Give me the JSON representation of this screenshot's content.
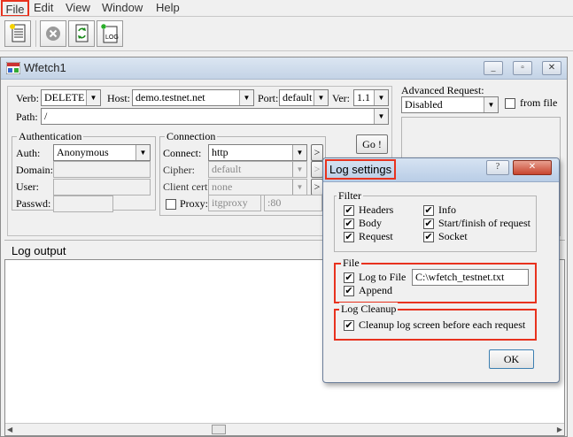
{
  "menu": {
    "items": [
      "File",
      "Edit",
      "View",
      "Window",
      "Help"
    ]
  },
  "toolbar": {
    "buttons": [
      "new-request-icon",
      "stop-icon",
      "refresh-icon",
      "log-icon"
    ],
    "log_text": "LOG"
  },
  "window": {
    "title": "Wfetch1",
    "minimize": "_",
    "restore": "▫",
    "close": "✕"
  },
  "request": {
    "verb_label": "Verb:",
    "verb_value": "DELETE",
    "host_label": "Host:",
    "host_value": "demo.testnet.net",
    "port_label": "Port:",
    "port_value": "default",
    "ver_label": "Ver:",
    "ver_value": "1.1",
    "path_label": "Path:",
    "path_value": "/",
    "advanced_label": "Advanced Request:",
    "advanced_value": "Disabled",
    "from_file_label": "from file"
  },
  "auth": {
    "group_title": "Authentication",
    "auth_label": "Auth:",
    "auth_value": "Anonymous",
    "domain_label": "Domain:",
    "user_label": "User:",
    "passwd_label": "Passwd:"
  },
  "connection": {
    "group_title": "Connection",
    "connect_label": "Connect:",
    "connect_value": "http",
    "cipher_label": "Cipher:",
    "cipher_value": "default",
    "client_cert_label": "Client cert:",
    "client_cert_value": "none",
    "proxy_label": "Proxy:",
    "proxy_value": "itgproxy",
    "proxy_port": ":80",
    "more_button": ">"
  },
  "go_button": "Go !",
  "log_output_label": "Log output",
  "dialog": {
    "title": "Log settings",
    "help": "?",
    "close": "✕",
    "filter": {
      "title": "Filter",
      "items": [
        {
          "label": "Headers",
          "checked": true
        },
        {
          "label": "Body",
          "checked": true
        },
        {
          "label": "Request",
          "checked": true
        },
        {
          "label": "Info",
          "checked": true
        },
        {
          "label": "Start/finish of request",
          "checked": true
        },
        {
          "label": "Socket",
          "checked": true
        }
      ]
    },
    "file": {
      "title": "File",
      "log_to_file_label": "Log to File",
      "log_to_file_checked": true,
      "path_value": "C:\\wfetch_testnet.txt",
      "append_label": "Append",
      "append_checked": true
    },
    "cleanup": {
      "title": "Log Cleanup",
      "label": "Cleanup log screen before each request",
      "checked": true
    },
    "ok_button": "OK"
  },
  "colors": {
    "highlight": "#e8321e",
    "title_bar": "#c4d3e6"
  }
}
